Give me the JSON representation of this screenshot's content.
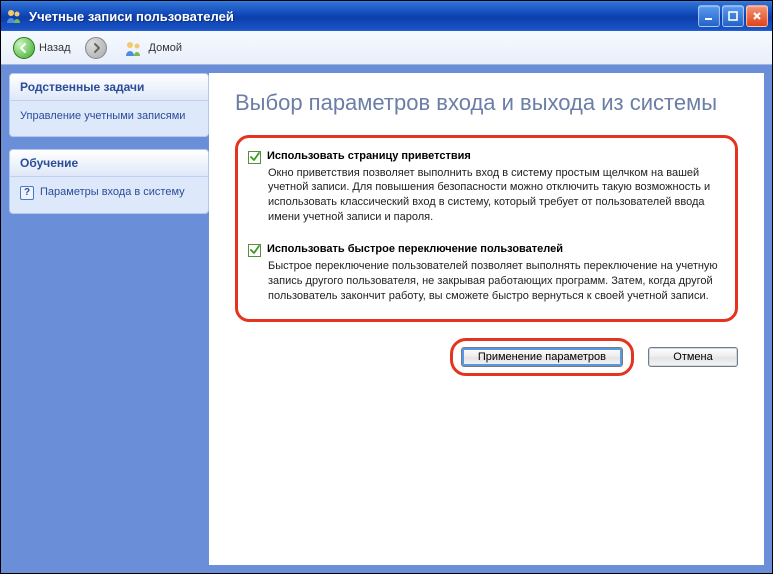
{
  "window": {
    "title": "Учетные записи пользователей"
  },
  "toolbar": {
    "back": "Назад",
    "home": "Домой"
  },
  "sidebar": {
    "panel1": {
      "header": "Родственные задачи",
      "link": "Управление учетными записями"
    },
    "panel2": {
      "header": "Обучение",
      "link": "Параметры входа в систему"
    }
  },
  "page": {
    "heading": "Выбор параметров входа и выхода из системы"
  },
  "option1": {
    "checked": true,
    "title": "Использовать страницу приветствия",
    "desc": "Окно приветствия позволяет выполнить вход в систему простым щелчком на вашей учетной записи. Для повышения безопасности можно отключить такую возможность и использовать классический вход в систему, который требует от пользователей ввода имени учетной записи и пароля."
  },
  "option2": {
    "checked": true,
    "title": "Использовать быстрое переключение пользователей",
    "desc": "Быстрое переключение пользователей позволяет выполнять переключение на учетную запись другого пользователя, не закрывая работающих программ. Затем, когда другой пользователь закончит работу, вы сможете быстро вернуться к своей учетной записи."
  },
  "buttons": {
    "apply": "Применение параметров",
    "cancel": "Отмена"
  },
  "colors": {
    "highlight": "#e4341f",
    "titlebar": "#1148b8",
    "link": "#2b4c97"
  }
}
